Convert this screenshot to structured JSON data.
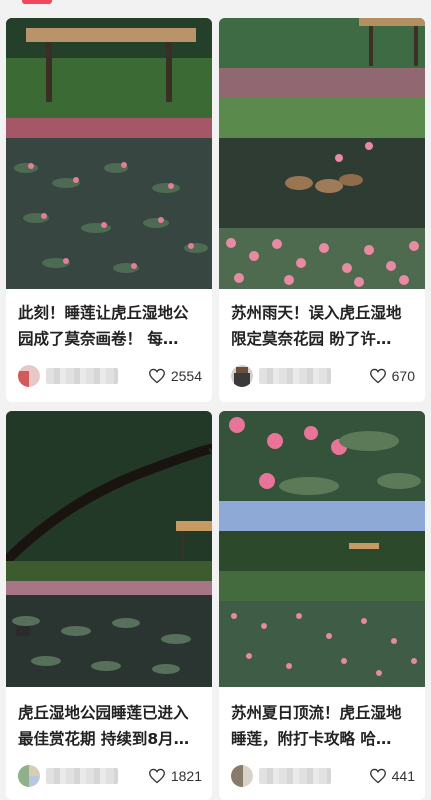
{
  "feed": {
    "cards": [
      {
        "title": "此刻！睡莲让虎丘湿地公园成了莫奈画卷！ 每…",
        "likes": "2554",
        "image": "lotus-pond-pavilion-photo"
      },
      {
        "title": "苏州雨天！误入虎丘湿地限定莫奈花园 盼了许…",
        "likes": "670",
        "image": "ducks-lotus-pond-photo"
      },
      {
        "title": "虎丘湿地公园睡莲已进入最佳赏花期 持续到8月…",
        "likes": "1821",
        "image": "willow-lake-water-lilies-photo"
      },
      {
        "title": "苏州夏日顶流！虎丘湿地睡莲，附打卡攻略 哈…",
        "likes": "441",
        "image": "pink-water-lilies-collage-photo"
      }
    ]
  },
  "icons": {
    "like": "heart-outline-icon"
  },
  "colors": {
    "accent": "#f0475a",
    "text": "#222222",
    "background": "#f2f2f2"
  }
}
